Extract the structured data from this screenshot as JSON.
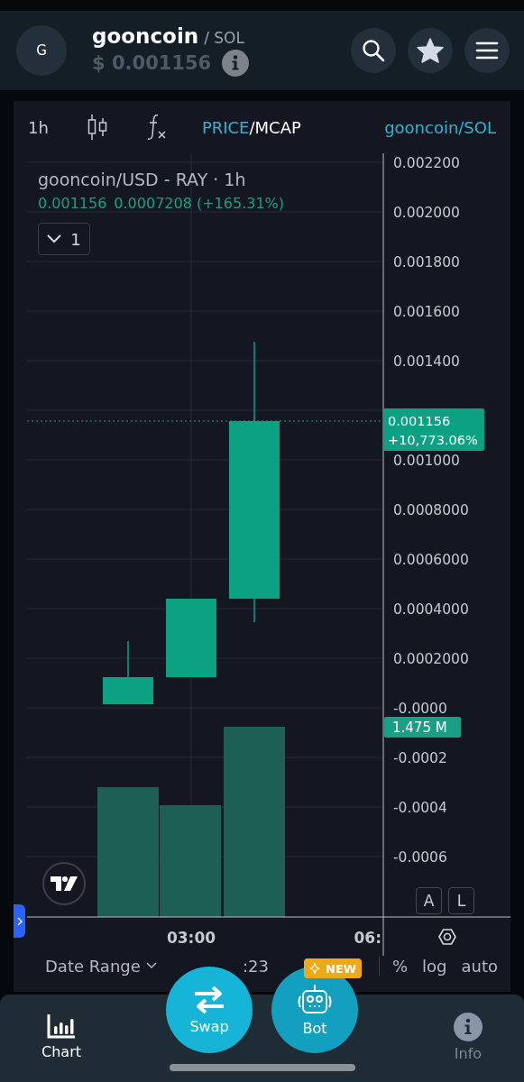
{
  "header": {
    "avatar": "G",
    "name": "gooncoin",
    "quote": "/ SOL",
    "price_symbol": "$",
    "price": "0.001156"
  },
  "toolbar": {
    "interval": "1h",
    "modes": [
      {
        "label": "PRICE",
        "selected": true
      },
      {
        "label": "MCAP",
        "selected": false
      }
    ],
    "mode_separator": "/",
    "pair": "gooncoin/SOL"
  },
  "legend": {
    "close": "0.001156",
    "change": "0.0007208 (+165.31%)",
    "collapse_count": "1"
  },
  "chart": {
    "title": "gooncoin/USD - RAY · 1h",
    "price_axis": [
      "0.002200",
      "0.002000",
      "0.001800",
      "0.001600",
      "0.001400",
      "0.001000",
      "0.0008000",
      "0.0006000",
      "0.0004000",
      "0.0002000",
      "-0.0000",
      "-0.0002",
      "-0.0004",
      "-0.0006"
    ],
    "time_axis": [
      "03:00",
      "06:"
    ]
  },
  "price_tag": {
    "price": "0.001156",
    "change": "+10,773.06%"
  },
  "volume_tag": "1.475 M",
  "scale_buttons": [
    "A",
    "L"
  ],
  "date_range": {
    "label": "Date Range",
    "time": ":23"
  },
  "scale_options": [
    "%",
    "log",
    "auto"
  ],
  "nav": {
    "items": [
      {
        "label": "Chart",
        "kind": "chart",
        "selected": true
      },
      {
        "label": "Info",
        "kind": "info",
        "selected": false
      }
    ],
    "actions": [
      {
        "label": "Swap",
        "kind": "swap"
      },
      {
        "label": "Bot",
        "kind": "bot",
        "badge": "NEW"
      }
    ]
  }
}
